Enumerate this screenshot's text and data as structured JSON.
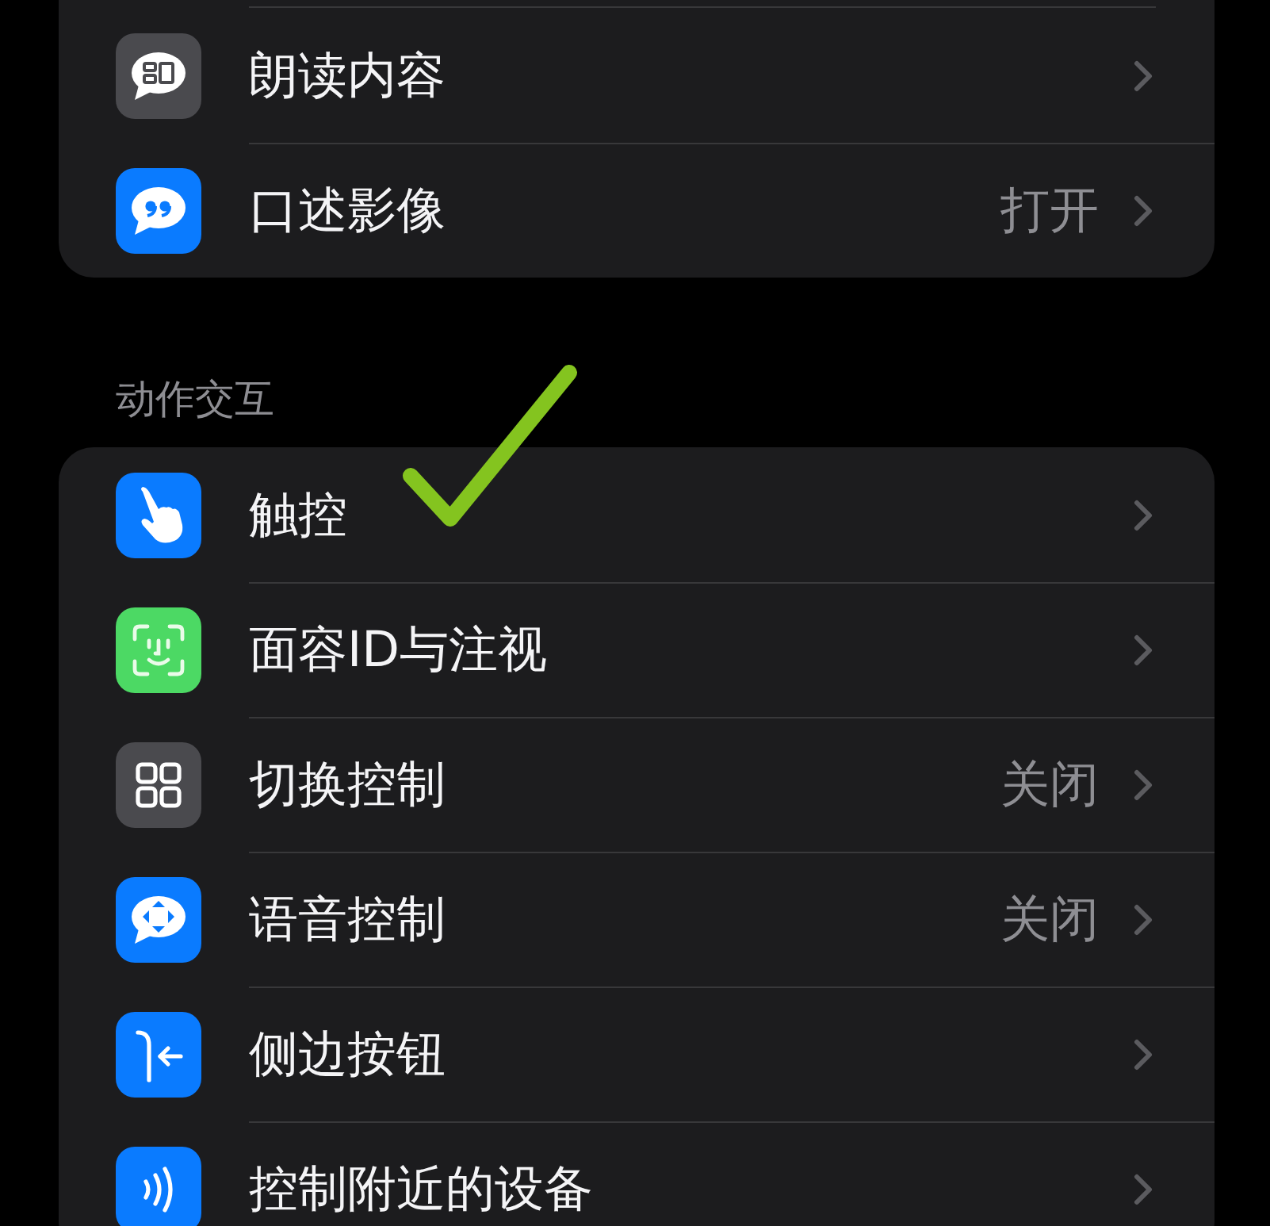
{
  "groups": [
    {
      "rows": [
        {
          "label": "朗读内容",
          "annotated": false
        },
        {
          "label": "口述影像",
          "value": "打开",
          "annotated": false
        }
      ]
    },
    {
      "header": "动作交互",
      "rows": [
        {
          "label": "触控",
          "annotated": true
        },
        {
          "label": "面容ID与注视",
          "annotated": false
        },
        {
          "label": "切换控制",
          "value": "关闭",
          "annotated": false
        },
        {
          "label": "语音控制",
          "value": "关闭",
          "annotated": false
        },
        {
          "label": "侧边按钮",
          "annotated": false
        },
        {
          "label": "控制附近的设备",
          "annotated": false
        }
      ]
    }
  ]
}
